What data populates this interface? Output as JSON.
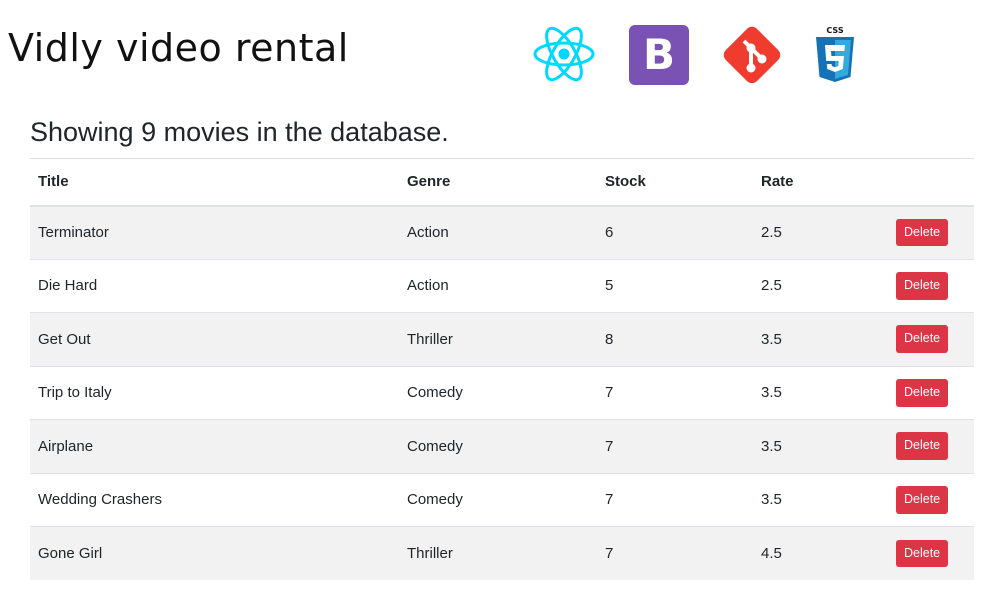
{
  "app": {
    "title": "Vidly video rental"
  },
  "logos": {
    "react": "react-logo",
    "bootstrap": {
      "icon": "bootstrap-logo",
      "letter": "B",
      "color": "#7952b3"
    },
    "git": {
      "icon": "git-logo",
      "color": "#f03c2e"
    },
    "css": {
      "icon": "css3-logo",
      "label": "CSS",
      "color": "#1572b6"
    }
  },
  "heading": "Showing 9 movies in the database.",
  "table": {
    "columns": [
      "Title",
      "Genre",
      "Stock",
      "Rate"
    ],
    "rows": [
      {
        "title": "Terminator",
        "genre": "Action",
        "stock": "6",
        "rate": "2.5",
        "action": "Delete"
      },
      {
        "title": "Die Hard",
        "genre": "Action",
        "stock": "5",
        "rate": "2.5",
        "action": "Delete"
      },
      {
        "title": "Get Out",
        "genre": "Thriller",
        "stock": "8",
        "rate": "3.5",
        "action": "Delete"
      },
      {
        "title": "Trip to Italy",
        "genre": "Comedy",
        "stock": "7",
        "rate": "3.5",
        "action": "Delete"
      },
      {
        "title": "Airplane",
        "genre": "Comedy",
        "stock": "7",
        "rate": "3.5",
        "action": "Delete"
      },
      {
        "title": "Wedding Crashers",
        "genre": "Comedy",
        "stock": "7",
        "rate": "3.5",
        "action": "Delete"
      },
      {
        "title": "Gone Girl",
        "genre": "Thriller",
        "stock": "7",
        "rate": "4.5",
        "action": "Delete"
      }
    ]
  },
  "colors": {
    "delete": "#dc3545",
    "stripe": "#f2f2f2",
    "react": "#00d8ff"
  }
}
